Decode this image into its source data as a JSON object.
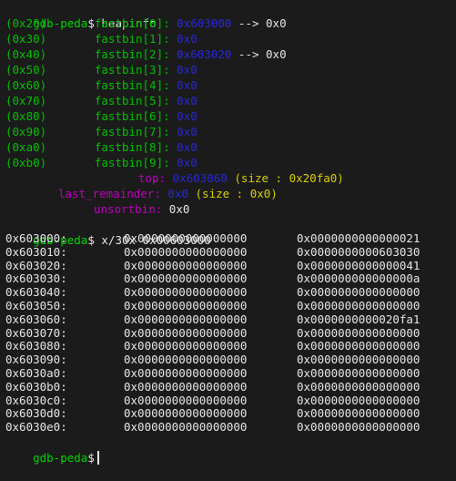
{
  "prompt": "gdb-peda",
  "prompt_symbol": "$",
  "commands": {
    "heapinfo": "heapinfo",
    "dump": "x/30x 0x00603000"
  },
  "fastbins": [
    {
      "size": "(0x20)",
      "label": "fastbin[0]:",
      "addr": "0x603000",
      "arrow": "--> 0x0"
    },
    {
      "size": "(0x30)",
      "label": "fastbin[1]:",
      "addr": "0x0",
      "arrow": ""
    },
    {
      "size": "(0x40)",
      "label": "fastbin[2]:",
      "addr": "0x603020",
      "arrow": "--> 0x0"
    },
    {
      "size": "(0x50)",
      "label": "fastbin[3]:",
      "addr": "0x0",
      "arrow": ""
    },
    {
      "size": "(0x60)",
      "label": "fastbin[4]:",
      "addr": "0x0",
      "arrow": ""
    },
    {
      "size": "(0x70)",
      "label": "fastbin[5]:",
      "addr": "0x0",
      "arrow": ""
    },
    {
      "size": "(0x80)",
      "label": "fastbin[6]:",
      "addr": "0x0",
      "arrow": ""
    },
    {
      "size": "(0x90)",
      "label": "fastbin[7]:",
      "addr": "0x0",
      "arrow": ""
    },
    {
      "size": "(0xa0)",
      "label": "fastbin[8]:",
      "addr": "0x0",
      "arrow": ""
    },
    {
      "size": "(0xb0)",
      "label": "fastbin[9]:",
      "addr": "0x0",
      "arrow": ""
    }
  ],
  "top": {
    "label": "top:",
    "addr": "0x603060",
    "info": "(size : 0x20fa0)"
  },
  "last_remainder": {
    "label": "last_remainder:",
    "addr": "0x0",
    "info": "(size : 0x0)"
  },
  "unsortbin": {
    "label": "unsortbin:",
    "value": "0x0"
  },
  "memory_rows": [
    {
      "addr": "0x603000:",
      "v1": "0x0000000000000000",
      "v2": "0x0000000000000021"
    },
    {
      "addr": "0x603010:",
      "v1": "0x0000000000000000",
      "v2": "0x0000000000603030"
    },
    {
      "addr": "0x603020:",
      "v1": "0x0000000000000000",
      "v2": "0x0000000000000041"
    },
    {
      "addr": "0x603030:",
      "v1": "0x0000000000000000",
      "v2": "0x000000000000000a"
    },
    {
      "addr": "0x603040:",
      "v1": "0x0000000000000000",
      "v2": "0x0000000000000000"
    },
    {
      "addr": "0x603050:",
      "v1": "0x0000000000000000",
      "v2": "0x0000000000000000"
    },
    {
      "addr": "0x603060:",
      "v1": "0x0000000000000000",
      "v2": "0x0000000000020fa1"
    },
    {
      "addr": "0x603070:",
      "v1": "0x0000000000000000",
      "v2": "0x0000000000000000"
    },
    {
      "addr": "0x603080:",
      "v1": "0x0000000000000000",
      "v2": "0x0000000000000000"
    },
    {
      "addr": "0x603090:",
      "v1": "0x0000000000000000",
      "v2": "0x0000000000000000"
    },
    {
      "addr": "0x6030a0:",
      "v1": "0x0000000000000000",
      "v2": "0x0000000000000000"
    },
    {
      "addr": "0x6030b0:",
      "v1": "0x0000000000000000",
      "v2": "0x0000000000000000"
    },
    {
      "addr": "0x6030c0:",
      "v1": "0x0000000000000000",
      "v2": "0x0000000000000000"
    },
    {
      "addr": "0x6030d0:",
      "v1": "0x0000000000000000",
      "v2": "0x0000000000000000"
    },
    {
      "addr": "0x6030e0:",
      "v1": "0x0000000000000000",
      "v2": "0x0000000000000000"
    }
  ]
}
